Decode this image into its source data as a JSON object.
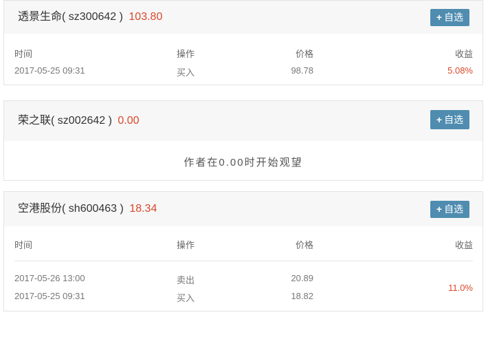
{
  "columns": {
    "time": "时间",
    "action": "操作",
    "price": "价格",
    "profit": "收益"
  },
  "add_label": "自选",
  "plus_glyph": "+",
  "stocks": [
    {
      "name": "透景生命",
      "code_open": "( sz300642 )",
      "price": "103.80",
      "trades": [
        {
          "time": "2017-05-25 09:31",
          "action": "买入",
          "price": "98.78"
        }
      ],
      "profit": "5.08%"
    },
    {
      "name": "荣之联",
      "code_open": "( sz002642 )",
      "price": "0.00",
      "note": "作者在0.00时开始观望"
    },
    {
      "name": "空港股份",
      "code_open": "( sh600463 )",
      "price": "18.34",
      "trades": [
        {
          "time": "2017-05-26 13:00",
          "action": "卖出",
          "price": "20.89"
        },
        {
          "time": "2017-05-25 09:31",
          "action": "买入",
          "price": "18.82"
        }
      ],
      "profit": "11.0%"
    }
  ]
}
